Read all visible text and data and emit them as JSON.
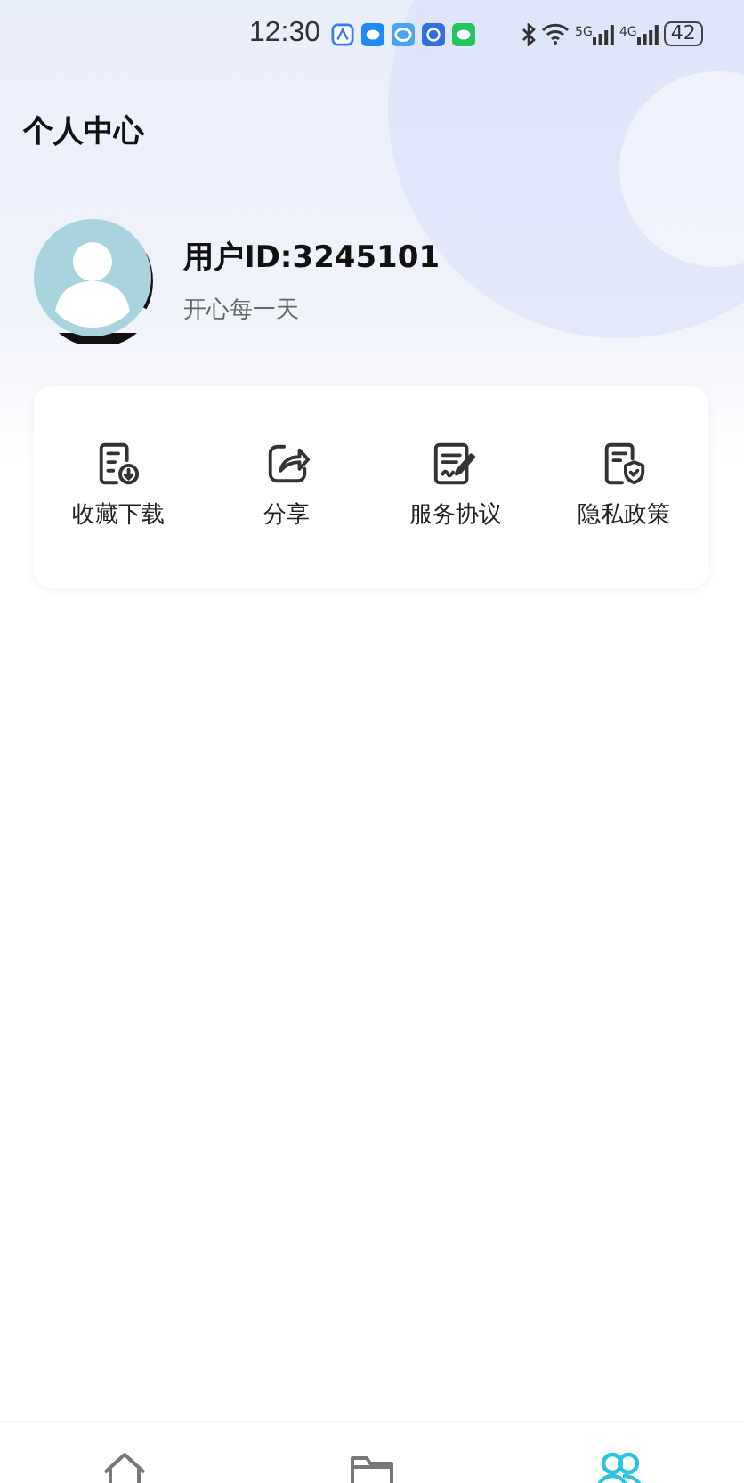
{
  "status_bar": {
    "time": "12:30",
    "notifications": [
      {
        "kind": "note",
        "color": "#3b7cf0"
      },
      {
        "kind": "chat",
        "color": "#1e8af5"
      },
      {
        "kind": "bubble",
        "color": "#4aa3f0"
      },
      {
        "kind": "app",
        "color": "#2f6fe0"
      },
      {
        "kind": "chat",
        "color": "#22c55e"
      }
    ],
    "signals": [
      {
        "label": "5G"
      },
      {
        "label": "4G"
      }
    ],
    "battery": "42"
  },
  "header": {
    "title": "个人中心"
  },
  "profile": {
    "user_id": "用户ID:3245101",
    "motto": "开心每一天"
  },
  "menu": [
    {
      "kind": "download",
      "label": "收藏下载"
    },
    {
      "kind": "share",
      "label": "分享"
    },
    {
      "kind": "agreement",
      "label": "服务协议"
    },
    {
      "kind": "privacy",
      "label": "隐私政策"
    }
  ],
  "nav": {
    "tabs": [
      {
        "kind": "home",
        "selected": false
      },
      {
        "kind": "folder",
        "selected": false
      },
      {
        "kind": "people",
        "selected": true
      }
    ]
  }
}
